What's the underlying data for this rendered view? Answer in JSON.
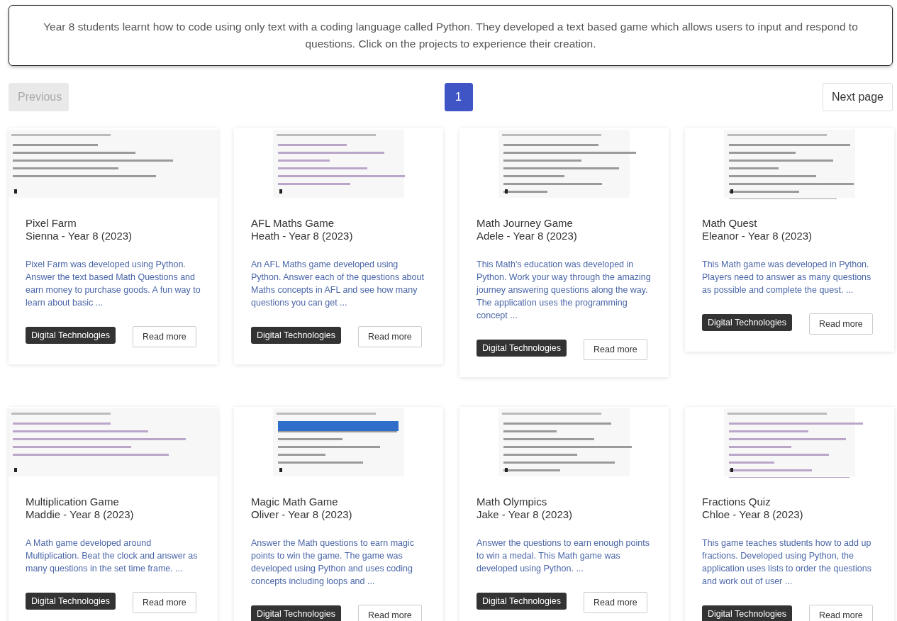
{
  "intro": "Year 8 students learnt how to code using only text with a coding language called Python. They developed a text based game which allows users to input and respond to questions. Click on the projects to experience their creation.",
  "pagination": {
    "previous": {
      "label": "Previous",
      "disabled": true
    },
    "pages": [
      {
        "label": "1",
        "selected": true
      }
    ],
    "next": {
      "label": "Next page",
      "disabled": false
    }
  },
  "projects": [
    {
      "title": "Pixel Farm",
      "author": "Sienna - Year 8 (2023)",
      "description": "Pixel Farm was developed using Python. Answer the text based Math Questions and earn money to purchase goods. A fun way to learn about basic ...",
      "tag": "Digital Technologies",
      "button": "Read more"
    },
    {
      "title": "AFL Maths Game",
      "author": "Heath - Year 8 (2023)",
      "description": "An AFL Maths game developed using Python. Answer each of the questions about Maths concepts in AFL and see how many questions you can get ...",
      "tag": "Digital Technologies",
      "button": "Read more"
    },
    {
      "title": "Math Journey Game",
      "author": "Adele - Year 8 (2023)",
      "description": "This Math's education was developed in Python. Work your way through the amazing journey answering questions along the way. The application uses the programming concept ...",
      "tag": "Digital Technologies",
      "button": "Read more"
    },
    {
      "title": "Math Quest",
      "author": "Eleanor - Year 8 (2023)",
      "description": "This Math game was developed in Python. Players need to answer as many questions as possible and complete the quest. ...",
      "tag": "Digital Technologies",
      "button": "Read more"
    },
    {
      "title": "Multiplication Game",
      "author": "Maddie - Year 8 (2023)",
      "description": "A Math game developed around Multiplication. Beat the clock and answer as many questions in the set time frame. ...",
      "tag": "Digital Technologies",
      "button": "Read more"
    },
    {
      "title": "Magic Math Game",
      "author": "Oliver - Year 8 (2023)",
      "description": "Answer the Math questions to earn magic points to win the game. The game was developed using Python and uses coding concepts including loops and ...",
      "tag": "Digital Technologies",
      "button": "Read more"
    },
    {
      "title": "Math Olympics",
      "author": "Jake - Year 8 (2023)",
      "description": "Answer the questions to earn enough points to win a medal. This Math game was developed using Python. ...",
      "tag": "Digital Technologies",
      "button": "Read more"
    },
    {
      "title": "Fractions Quiz",
      "author": "Chloe - Year 8 (2023)",
      "description": "This game teaches students how to add up fractions. Developed using Python, the application uses lists to order the questions and work out of user ...",
      "tag": "Digital Technologies",
      "button": "Read more"
    }
  ]
}
